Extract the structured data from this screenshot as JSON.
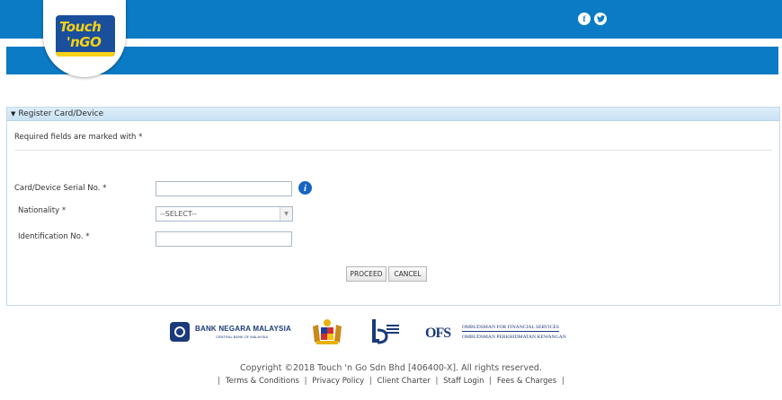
{
  "header": {
    "logo_text_line1": "Touch",
    "logo_text_line2": "'nGO",
    "social": [
      {
        "icon": "facebook-icon",
        "glyph": "f"
      },
      {
        "icon": "twitter-icon",
        "glyph": "t"
      }
    ],
    "colors": {
      "brand_blue": "#0a7bc4",
      "logo_yellow": "#f7d117"
    }
  },
  "panel": {
    "title": "Register Card/Device",
    "required_note": "Required fields are marked with *",
    "fields": {
      "serial_label": "Card/Device Serial No. *",
      "serial_value": "",
      "nationality_label": "Nationality *",
      "nationality_selected": "--SELECT--",
      "id_label": "Identification No. *",
      "id_value": ""
    },
    "buttons": {
      "proceed": "PROCEED",
      "cancel": "CANCEL"
    }
  },
  "footer": {
    "bnm_name": "BANK NEGARA MALAYSIA",
    "bnm_sub": "CENTRAL BANK OF MALAYSIA",
    "ofs_mark": "OFS",
    "ofs_line1": "OMBUDSMAN FOR FINANCIAL SERVICES",
    "ofs_line2": "OMBUDSMAN PERKHIDMATAN KEWANGAN",
    "copyright": "Copyright ©2018 Touch 'n Go Sdn Bhd [406400-X]. All rights reserved.",
    "links": [
      "Terms & Conditions",
      "Privacy Policy",
      "Client Charter",
      "Staff Login",
      "Fees & Charges"
    ]
  }
}
